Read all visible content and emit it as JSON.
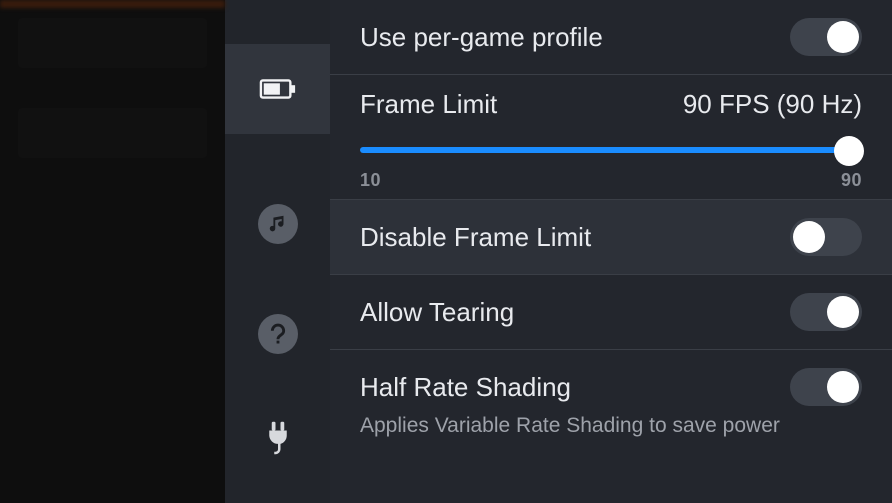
{
  "sidebar": {
    "items": [
      {
        "name": "performance",
        "icon": "battery"
      },
      {
        "name": "audio",
        "icon": "music"
      },
      {
        "name": "help",
        "icon": "help"
      },
      {
        "name": "power",
        "icon": "plug"
      }
    ]
  },
  "settings": {
    "per_game_profile": {
      "label": "Use per-game profile",
      "on": true
    },
    "frame_limit": {
      "label": "Frame Limit",
      "value": "90 FPS (90 Hz)",
      "min": "10",
      "max": "90"
    },
    "disable_frame_limit": {
      "label": "Disable Frame Limit",
      "on": false
    },
    "allow_tearing": {
      "label": "Allow Tearing",
      "on": true
    },
    "half_rate_shading": {
      "label": "Half Rate Shading",
      "on": true,
      "description": "Applies Variable Rate Shading to save power"
    }
  }
}
